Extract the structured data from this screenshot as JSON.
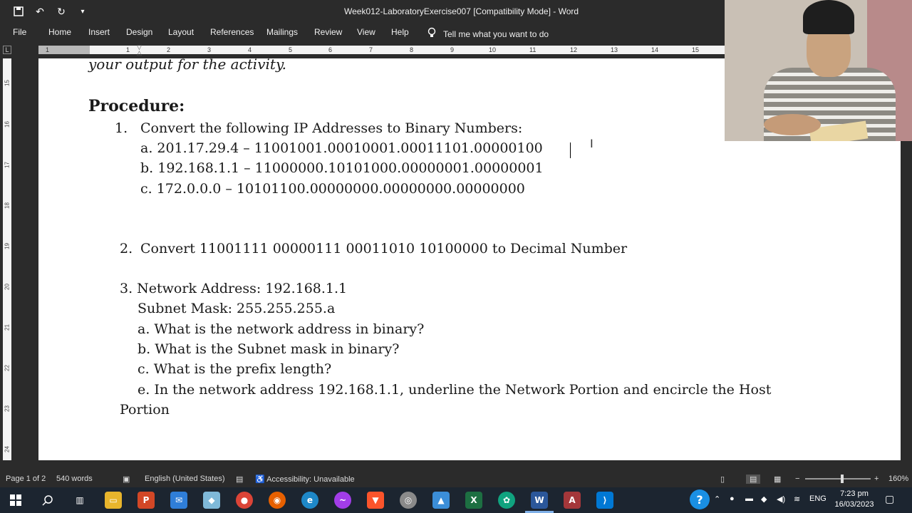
{
  "window": {
    "title": "Week012-LaboratoryExercise007 [Compatibility Mode]  -  Word"
  },
  "ribbon": {
    "tabs": [
      "File",
      "Home",
      "Insert",
      "Design",
      "Layout",
      "References",
      "Mailings",
      "Review",
      "View",
      "Help"
    ],
    "tell_me": "Tell me what you want to do"
  },
  "ruler": {
    "numbers": [
      "1",
      "1",
      "2",
      "3",
      "4",
      "5",
      "6",
      "7",
      "8",
      "9",
      "10",
      "11",
      "12",
      "13",
      "14",
      "15"
    ],
    "vertical_numbers": [
      "15",
      "16",
      "17",
      "18",
      "19",
      "20",
      "21",
      "22",
      "23",
      "24"
    ]
  },
  "document": {
    "intro_tail": "your output for the activity.",
    "heading": "Procedure:",
    "item1": {
      "num": "1.",
      "text": "Convert the following IP Addresses to Binary Numbers:",
      "a": "a. 201.17.29.4  – 11001001.00010001.00011101.00000100",
      "b": "b. 192.168.1.1  – 11000000.10101000.00000001.00000001",
      "c": "c. 172.0.0.0  – 10101100.00000000.00000000.00000000"
    },
    "item2": {
      "num": "2.",
      "text": "Convert 11001111 00000111 00011010 10100000 to Decimal Number"
    },
    "item3": {
      "line1": "3. Network Address: 192.168.1.1",
      "line2": "Subnet Mask: 255.255.255.a",
      "a": "a. What is the network address in binary?",
      "b": "b. What is the Subnet mask in binary?",
      "c": "c. What is the prefix length?",
      "e": "e. In the network address 192.168.1.1, underline the Network Portion and encircle the Host",
      "e_cont": "Portion"
    }
  },
  "statusbar": {
    "page": "Page 1 of 2",
    "words": "540 words",
    "language": "English (United States)",
    "accessibility": "Accessibility: Unavailable",
    "zoom": "160%"
  },
  "taskbar": {
    "language": "ENG",
    "time": "7:23 pm",
    "date": "16/03/2023"
  },
  "colors": {
    "chrome": "#2b2b2b",
    "page": "#ffffff",
    "taskbar": "#1c2530"
  }
}
